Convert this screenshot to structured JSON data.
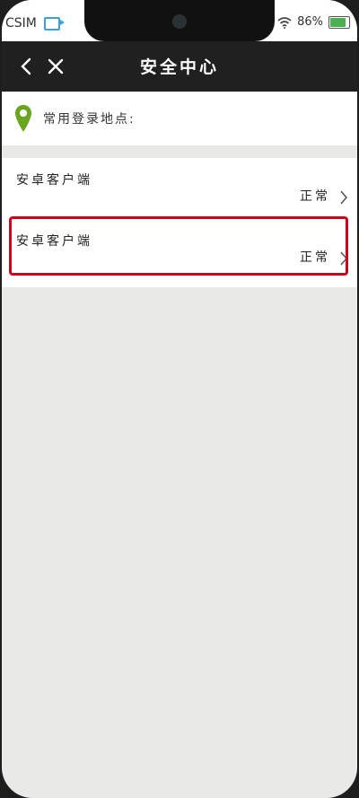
{
  "status_bar": {
    "carrier": "CSIM",
    "battery": "86%",
    "battery_level": 0.86
  },
  "nav": {
    "title": "安全中心",
    "back_icon": "chevron-left-icon",
    "close_icon": "close-icon"
  },
  "location": {
    "icon": "location-pin-icon",
    "label": "常用登录地点:"
  },
  "devices": [
    {
      "name": "安卓客户端",
      "status": "正常"
    },
    {
      "name": "安卓客户端",
      "status": "正常"
    }
  ],
  "colors": {
    "nav_bg": "#202020",
    "pin": "#6aa51f",
    "highlight": "#d0021b",
    "background": "#e9eae8"
  }
}
